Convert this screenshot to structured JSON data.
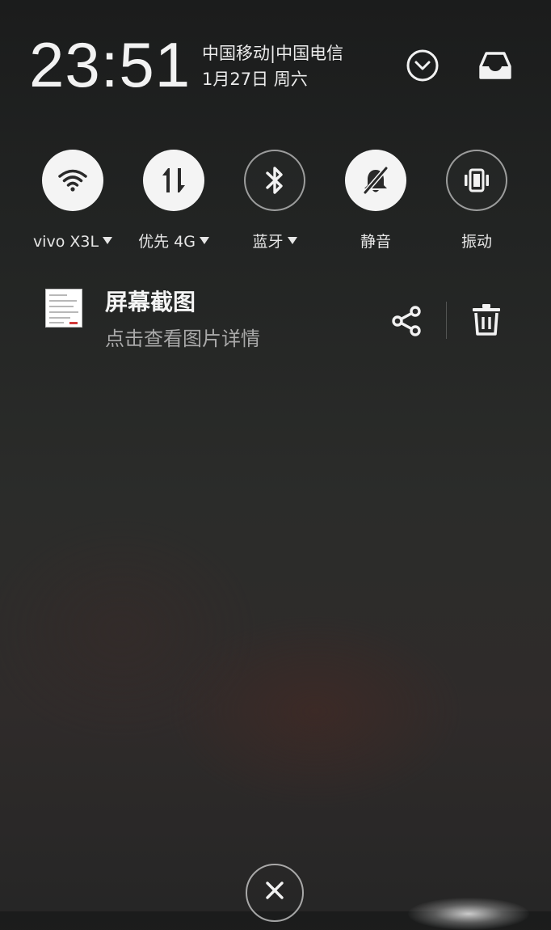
{
  "status": {
    "time": "23:51",
    "carrier": "中国移动|中国电信",
    "date": "1月27日 周六"
  },
  "header_icons": {
    "expand": "chevron-down-circle-icon",
    "notifications": "inbox-icon"
  },
  "toggles": [
    {
      "label": "vivo X3L",
      "icon": "wifi-icon",
      "active": true,
      "has_dropdown": true
    },
    {
      "label": "优先 4G",
      "icon": "mobile-data-icon",
      "active": true,
      "has_dropdown": true
    },
    {
      "label": "蓝牙",
      "icon": "bluetooth-icon",
      "active": false,
      "has_dropdown": true
    },
    {
      "label": "静音",
      "icon": "bell-off-icon",
      "active": true,
      "has_dropdown": false
    },
    {
      "label": "振动",
      "icon": "vibrate-icon",
      "active": false,
      "has_dropdown": false
    }
  ],
  "notification": {
    "title": "屏幕截图",
    "description": "点击查看图片详情",
    "actions": {
      "share": "share-icon",
      "delete": "trash-icon"
    }
  },
  "colors": {
    "active_toggle_bg": "#f4f4f4",
    "active_toggle_icon": "#2a2a2a",
    "inactive_toggle_ring": "#8c8c8c",
    "text_primary": "#f4f4f4",
    "text_secondary": "#a9a9a9"
  }
}
